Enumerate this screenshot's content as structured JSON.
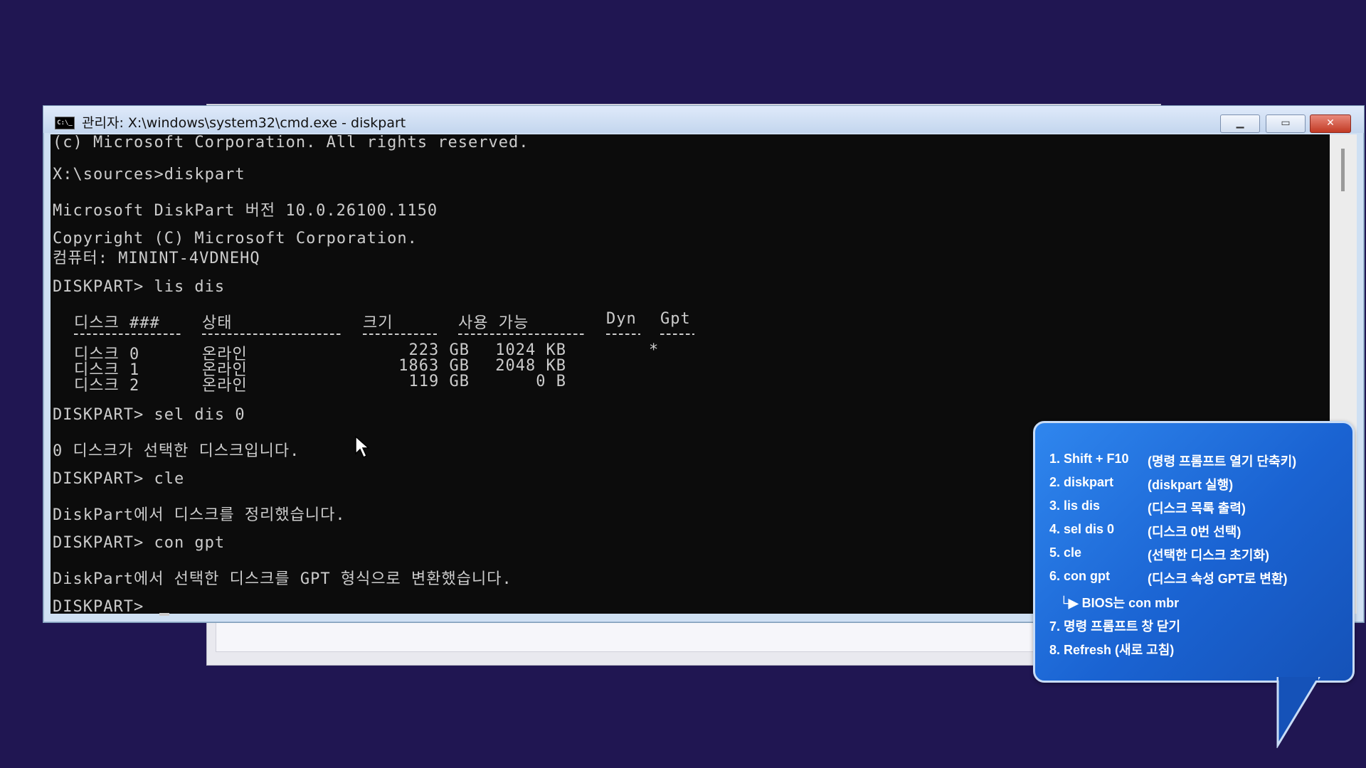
{
  "window": {
    "title": "관리자: X:\\windows\\system32\\cmd.exe - diskpart",
    "icon_text": "C:\\_"
  },
  "console": {
    "lines": [
      "(c) Microsoft Corporation. All rights reserved.",
      "X:\\sources>diskpart",
      "Microsoft DiskPart 버전 10.0.26100.1150",
      "Copyright (C) Microsoft Corporation.",
      "컴퓨터: MININT-4VDNEHQ",
      "DISKPART> lis dis",
      "DISKPART> sel dis 0",
      "0 디스크가 선택한 디스크입니다.",
      "DISKPART> cle",
      "DiskPart에서 디스크를 정리했습니다.",
      "DISKPART> con gpt",
      "DiskPart에서 선택한 디스크를 GPT 형식으로 변환했습니다.",
      "DISKPART> "
    ],
    "table": {
      "headers": [
        "디스크 ###",
        "상태",
        "크기",
        "사용 가능",
        "Dyn",
        "Gpt"
      ],
      "rows": [
        [
          "디스크 0",
          "온라인",
          "223 GB",
          "1024 KB",
          "",
          "*"
        ],
        [
          "디스크 1",
          "온라인",
          "1863 GB",
          "2048 KB",
          "",
          ""
        ],
        [
          "디스크 2",
          "온라인",
          "119 GB",
          "0 B",
          "",
          ""
        ]
      ]
    }
  },
  "callout": {
    "steps": [
      {
        "cmd": "1. Shift + F10",
        "desc": "(명령 프롬프트 열기 단축키)"
      },
      {
        "cmd": "2. diskpart",
        "desc": "(diskpart 실행)"
      },
      {
        "cmd": "3. lis dis",
        "desc": "(디스크 목록 출력)"
      },
      {
        "cmd": "4. sel dis 0",
        "desc": "(디스크 0번 선택)"
      },
      {
        "cmd": "5. cle",
        "desc": "(선택한 디스크 초기화)"
      },
      {
        "cmd": "6. con gpt",
        "desc": "(디스크 속성 GPT로 변환)"
      },
      {
        "cmd": "7. 명령 프롬프트 창 닫기",
        "desc": ""
      },
      {
        "cmd": "8. Refresh (새로 고침)",
        "desc": ""
      }
    ],
    "sub_note": "└▶ BIOS는 con mbr"
  },
  "colors": {
    "desktop": "#201652",
    "console_bg": "#0c0c0c",
    "console_text": "#cccccc",
    "callout_blue": "#1a63d2"
  }
}
